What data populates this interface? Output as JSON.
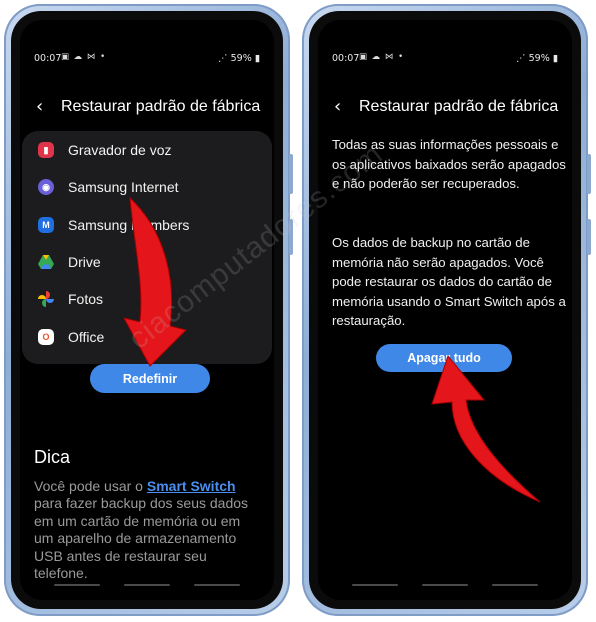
{
  "left": {
    "status": {
      "time": "00:07",
      "icons": "▣ ☁ ⋈ •",
      "battery": "59%"
    },
    "header": {
      "title": "Restaurar padrão de fábrica"
    },
    "apps": [
      {
        "label": "Gravador de voz",
        "icon": "voice-recorder-icon",
        "color": "#e0344a"
      },
      {
        "label": "Samsung Internet",
        "icon": "samsung-internet-icon",
        "color": "#6a5fd8"
      },
      {
        "label": "Samsung Members",
        "icon": "samsung-members-icon",
        "color": "#1f6fe0"
      },
      {
        "label": "Drive",
        "icon": "google-drive-icon",
        "color": "#34a853"
      },
      {
        "label": "Fotos",
        "icon": "google-photos-icon",
        "color": "#fbbc05"
      },
      {
        "label": "Office",
        "icon": "office-icon",
        "color": "#e8562a"
      }
    ],
    "reset_button": "Redefinir",
    "tip": {
      "title": "Dica",
      "text_before": "Você pode usar o ",
      "link": "Smart Switch",
      "text_after": " para fazer backup dos seus dados em um cartão de memória ou em um aparelho de armazenamento USB antes de restaurar seu telefone."
    }
  },
  "right": {
    "status": {
      "time": "00:07",
      "icons": "▣ ☁ ⋈ •",
      "battery": "59%"
    },
    "header": {
      "title": "Restaurar padrão de fábrica"
    },
    "info_1": "Todas as suas informações pessoais e os aplicativos baixados serão apagados e não poderão ser recuperados.",
    "info_2": "Os dados de backup no cartão de memória não serão apagados. Você pode restaurar os dados do cartão de memória usando o Smart Switch após a restauração.",
    "erase_button": "Apagar tudo"
  },
  "watermark": "ciacomputadores.com",
  "colors": {
    "accent": "#3f88e8",
    "arrow": "#e4161b",
    "frame": "#9db6dc"
  }
}
